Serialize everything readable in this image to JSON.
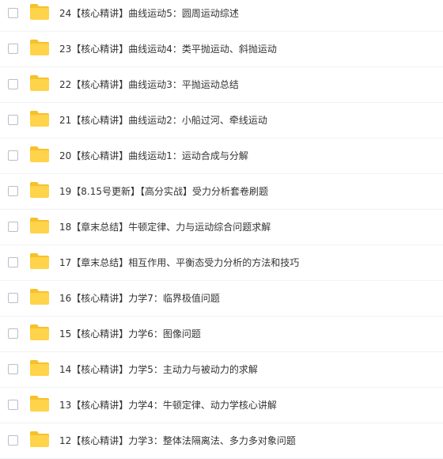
{
  "files": [
    {
      "name": "24【核心精讲】曲线运动5：圆周运动综述",
      "icon": "folder-icon"
    },
    {
      "name": "23【核心精讲】曲线运动4：类平抛运动、斜抛运动",
      "icon": "folder-icon"
    },
    {
      "name": "22【核心精讲】曲线运动3：平抛运动总结",
      "icon": "folder-icon"
    },
    {
      "name": "21【核心精讲】曲线运动2：小船过河、牵线运动",
      "icon": "folder-icon"
    },
    {
      "name": "20【核心精讲】曲线运动1：运动合成与分解",
      "icon": "folder-icon"
    },
    {
      "name": "19【8.15号更新】【高分实战】受力分析套卷刷题",
      "icon": "folder-icon"
    },
    {
      "name": "18【章末总结】牛顿定律、力与运动综合问题求解",
      "icon": "folder-icon"
    },
    {
      "name": "17【章末总结】相互作用、平衡态受力分析的方法和技巧",
      "icon": "folder-icon"
    },
    {
      "name": "16【核心精讲】力学7：临界极值问题",
      "icon": "folder-icon"
    },
    {
      "name": "15【核心精讲】力学6：图像问题",
      "icon": "folder-icon"
    },
    {
      "name": "14【核心精讲】力学5：主动力与被动力的求解",
      "icon": "folder-icon"
    },
    {
      "name": "13【核心精讲】力学4：牛顿定律、动力学核心讲解",
      "icon": "folder-icon"
    },
    {
      "name": "12【核心精讲】力学3：整体法隔离法、多力多对象问题",
      "icon": "folder-icon"
    }
  ],
  "colors": {
    "folder_body": "#ffd34a",
    "folder_back": "#f6c12c",
    "row_divider": "#f1f2f4",
    "text": "#333333"
  }
}
